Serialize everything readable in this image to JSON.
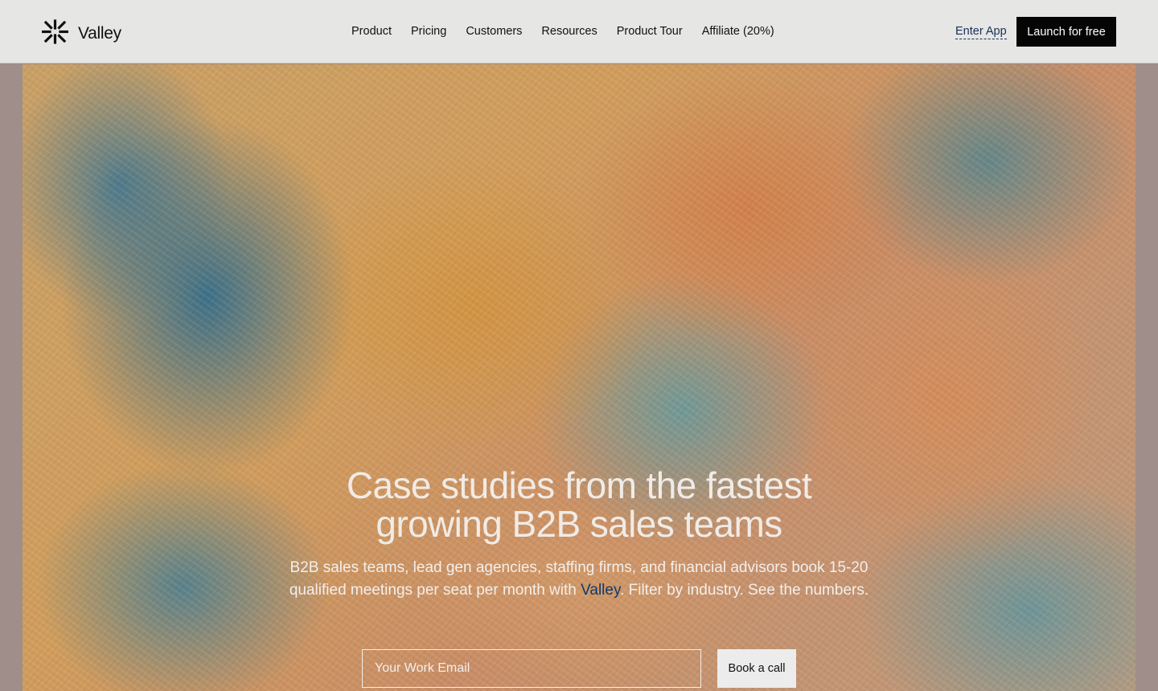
{
  "header": {
    "brand_name": "Valley",
    "nav": [
      {
        "label": "Product"
      },
      {
        "label": "Pricing"
      },
      {
        "label": "Customers"
      },
      {
        "label": "Resources"
      },
      {
        "label": "Product Tour"
      },
      {
        "label": "Affiliate (20%)"
      }
    ],
    "enter_app_label": "Enter App",
    "launch_label": "Launch for free"
  },
  "hero": {
    "headline_line1": "Case studies from the fastest",
    "headline_line2": "growing B2B sales teams",
    "sub_part1": "B2B sales teams, lead gen agencies, staffing firms, and financial advisors book 15-20 qualified meetings per seat per month with ",
    "sub_brand": "Valley",
    "sub_part2": ". Filter by industry. See the numbers.",
    "email_placeholder": "Your Work Email",
    "book_call_label": "Book a call"
  },
  "colors": {
    "header_bg": "#e6e6e5",
    "launch_bg": "#050505",
    "brand_link": "#103a6e"
  },
  "icons": {
    "logo": "asterisk-burst-icon"
  }
}
